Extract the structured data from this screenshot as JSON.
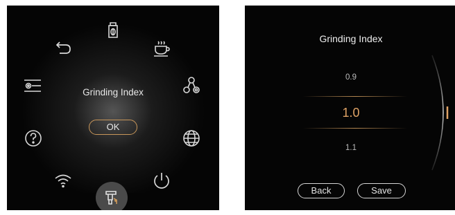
{
  "left_screen": {
    "center_label": "Grinding Index",
    "ok_label": "OK",
    "menu_icons": [
      "bean-hopper-icon",
      "coffee-cup-icon",
      "share-icon",
      "globe-icon",
      "power-icon",
      "grinder-icon",
      "wifi-icon",
      "help-icon",
      "settings-sliders-icon",
      "back-arrow-icon"
    ],
    "selected_icon": "grinder-icon"
  },
  "right_screen": {
    "title": "Grinding Index",
    "values": [
      "0.9",
      "1.0",
      "1.1"
    ],
    "selected_value": "1.0",
    "back_label": "Back",
    "save_label": "Save"
  },
  "colors": {
    "background": "#050505",
    "accent": "#c9975a",
    "highlight_value": "#e0a366",
    "text": "#e8e8e8"
  }
}
